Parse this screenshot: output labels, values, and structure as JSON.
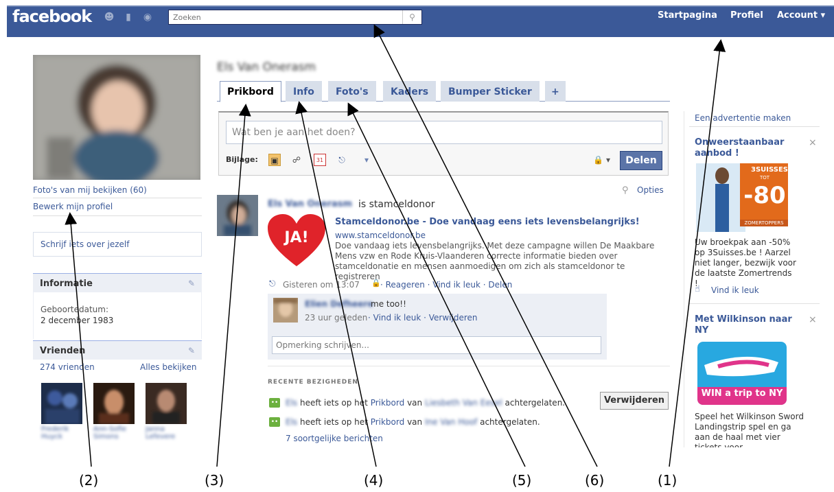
{
  "header": {
    "logo": "facebook",
    "search_placeholder": "Zoeken",
    "nav": [
      "Startpagina",
      "Profiel",
      "Account ▾"
    ]
  },
  "left": {
    "photos_link": "Foto's van mij bekijken (60)",
    "edit_profile": "Bewerk mijn profiel",
    "about_placeholder": "Schrijf iets over jezelf",
    "info_title": "Informatie",
    "birthday_label": "Geboortedatum:",
    "birthday_value": "2 december 1983",
    "friends_title": "Vrienden",
    "friends_count": "274 vrienden",
    "friends_all": "Alles bekijken"
  },
  "main": {
    "profile_name": "Els Van Onerasm",
    "tabs": [
      "Prikbord",
      "Info",
      "Foto's",
      "Kaders",
      "Bumper Sticker",
      "+"
    ],
    "status_placeholder": "Wat ben je aan het doen?",
    "attach_label": "Bijlage:",
    "share_button": "Delen",
    "options": "Opties",
    "post": {
      "author": "Els Van Onerasm",
      "action": "is stamceldonor",
      "link_title": "Stamceldonor.be - Doe vandaag eens iets levensbelangrijks!",
      "link_url": "www.stamceldonor.be",
      "link_desc": "Doe vandaag iets levensbelangrijks. Met deze campagne willen De Maakbare Mens vzw en Rode Kruis-Vlaanderen correcte informatie bieden over stamceldonatie en mensen aanmoedigen om zich als stamceldonor te registreren",
      "heart_text": "JA!",
      "time": "Gisteren om 13:07",
      "actions": "· Reageren · Vind ik leuk · Delen",
      "comment_author": "Elien Defheere",
      "comment_text": "me too!!",
      "comment_time": "23 uur geleden",
      "comment_actions": "· Vind ik leuk · Verwijderen",
      "comment_placeholder": "Opmerking schrijven..."
    },
    "recent": {
      "title": "RECENTE BEZIGHEDEN",
      "item1_pre": "heeft iets op het",
      "item1_link": "Prikbord",
      "item1_mid": "van",
      "item1_post": "achtergelaten.",
      "item2_pre": "heeft iets op het",
      "item2_link": "Prikbord",
      "item2_mid": "van",
      "item2_post": "achtergelaten.",
      "more": "7 soortgelijke berichten",
      "delete_button": "Verwijderen"
    }
  },
  "ads": {
    "create": "Een advertentie maken",
    "ad1_title": "Onweerstaanbaar aanbod !",
    "ad1_badge_brand": "3SUISSES",
    "ad1_badge_sub": "TOT",
    "ad1_badge_value": "-80",
    "ad1_badge_strip": "ZOMERTOPPERS",
    "ad1_text": "Uw broekpak aan -50% op 3Suisses.be ! Aarzel niet langer, bezwijk voor de laatste Zomertrends !",
    "ad1_like": "Vind ik leuk",
    "ad2_title": "Met Wilkinson naar NY",
    "ad2_banner": "WIN a trip to NY",
    "ad2_text": "Speel het Wilkinson Sword Landingstrip spel en ga aan de haal met vier tickets voor"
  },
  "callouts": [
    "(1)",
    "(2)",
    "(3)",
    "(4)",
    "(5)",
    "(6)"
  ]
}
